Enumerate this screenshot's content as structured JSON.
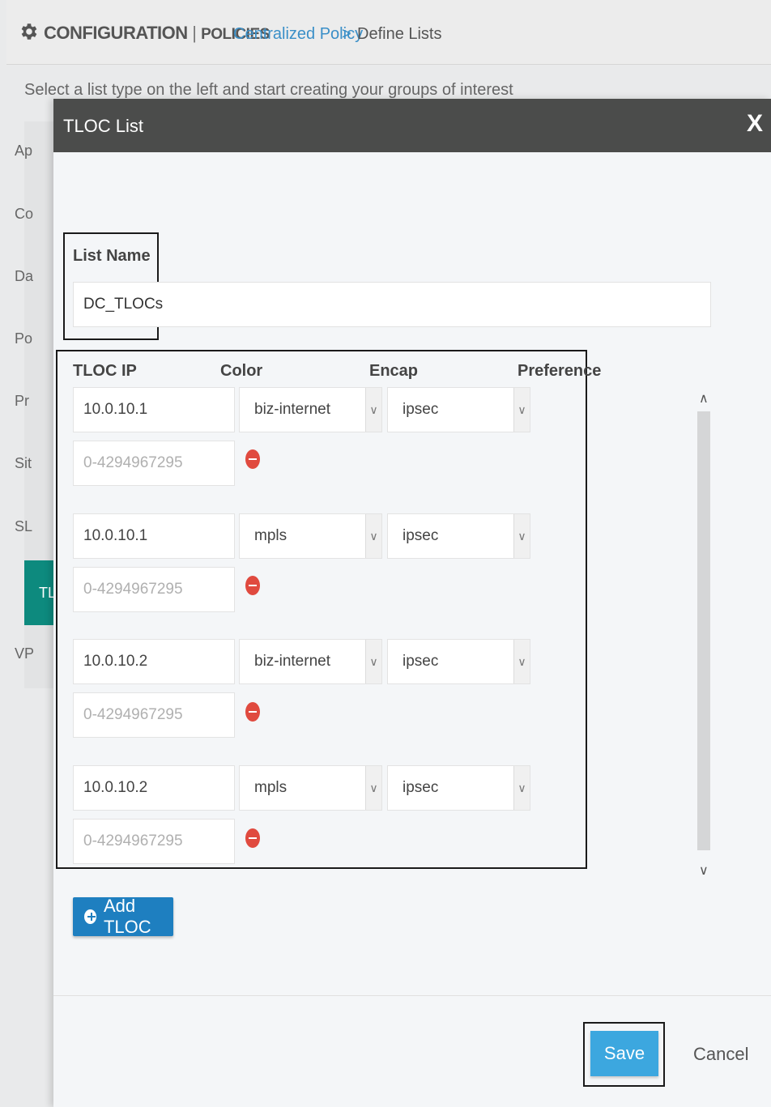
{
  "header": {
    "section": "CONFIGURATION",
    "separator": "|",
    "subsection": "POLICIES",
    "breadcrumb_link": "Centralized Policy",
    "breadcrumb_arrow": ">",
    "breadcrumb_current": "Define Lists"
  },
  "hint": "Select a list type on the left and start creating your groups of interest",
  "left_list": {
    "items": [
      {
        "label": "Ap"
      },
      {
        "label": "Co"
      },
      {
        "label": "Da"
      },
      {
        "label": "Po"
      },
      {
        "label": "Pr"
      },
      {
        "label": "Sit"
      },
      {
        "label": "SL"
      },
      {
        "label": "TL"
      },
      {
        "label": "VP"
      }
    ],
    "active_index": 7
  },
  "modal": {
    "title": "TLOC List",
    "close_label": "X",
    "list_name_label": "List Name",
    "list_name_value": "DC_TLOCs",
    "columns": {
      "tloc_ip": "TLOC IP",
      "color": "Color",
      "encap": "Encap",
      "preference": "Preference"
    },
    "rows": [
      {
        "tloc_ip": "10.0.10.1",
        "color": "biz-internet",
        "encap": "ipsec",
        "preference_placeholder": "0-4294967295"
      },
      {
        "tloc_ip": "10.0.10.1",
        "color": "mpls",
        "encap": "ipsec",
        "preference_placeholder": "0-4294967295"
      },
      {
        "tloc_ip": "10.0.10.2",
        "color": "biz-internet",
        "encap": "ipsec",
        "preference_placeholder": "0-4294967295"
      },
      {
        "tloc_ip": "10.0.10.2",
        "color": "mpls",
        "encap": "ipsec",
        "preference_placeholder": "0-4294967295"
      }
    ],
    "add_tloc_label": "Add TLOC",
    "save_label": "Save",
    "cancel_label": "Cancel"
  },
  "colors": {
    "modal_header": "#4b4c4b",
    "active_item": "#0d8a7e",
    "add_button": "#1e7fc0",
    "save_button": "#3ca7df",
    "remove_icon": "#e04a3f",
    "link": "#3a8fc8"
  }
}
